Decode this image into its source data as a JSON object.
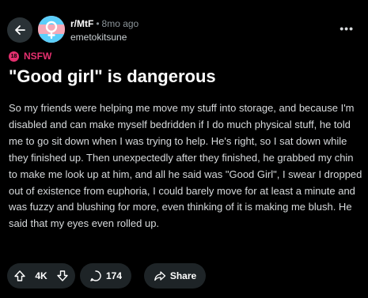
{
  "header": {
    "subreddit": "r/MtF",
    "separator": "•",
    "time_ago": "8mo ago",
    "username": "emetokitsune",
    "more_label": "•••"
  },
  "post": {
    "nsfw_icon": "18",
    "nsfw_label": "NSFW",
    "title": "\"Good girl\" is dangerous",
    "body": "So my friends were helping me move my stuff into storage, and because I'm disabled and can make myself bedridden if I do much physical stuff, he told me to go sit down when I was trying to help. He's right, so I sat down while they finished up. Then unexpectedly after they finished, he grabbed my chin to make me look up at him, and all he said was \"Good Girl\", I swear I dropped out of existence from euphoria, I could barely move for at least a minute and was fuzzy and blushing for more, even thinking of it is making me blush. He said that my eyes even rolled up."
  },
  "actions": {
    "upvotes": "4K",
    "comments": "174",
    "share_label": "Share"
  },
  "colors": {
    "background": "#000000",
    "nsfw": "#e5306f",
    "pill": "#1e2427",
    "avatar_bg": "#f1c7dc"
  },
  "icons": [
    "back-arrow-icon",
    "subreddit-avatar-icon",
    "nsfw-icon",
    "more-icon",
    "upvote-icon",
    "downvote-icon",
    "comment-icon",
    "share-icon"
  ]
}
